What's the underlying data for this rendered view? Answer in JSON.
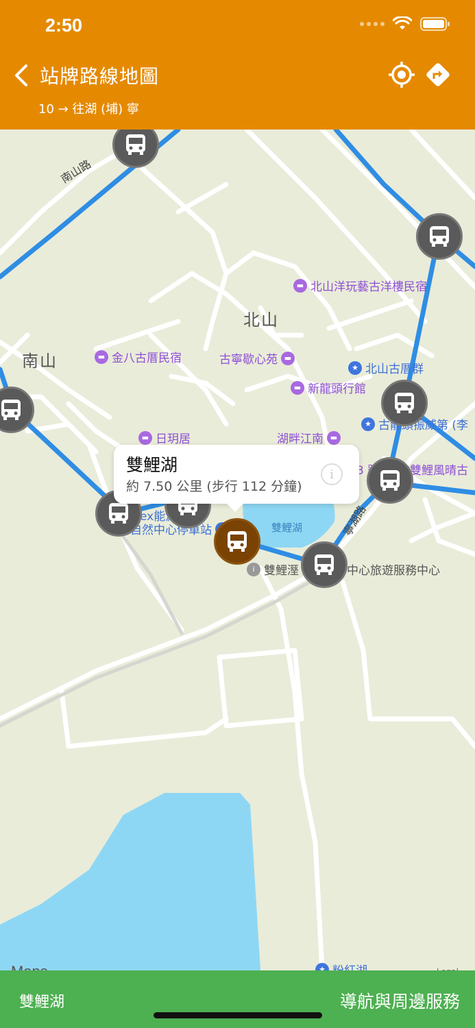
{
  "status_bar": {
    "time": "2:50"
  },
  "header": {
    "title": "站牌路線地圖",
    "subtitle": "10 → 往湖 (埔) 寧"
  },
  "map": {
    "place_labels": {
      "beishan": "北山",
      "nanshan": "南山"
    },
    "road_labels": {
      "nanshan_road": "南山路",
      "ningHu_road": "寧湖路"
    },
    "water_label": "雙鯉湖",
    "pois": {
      "p1": "北山洋玩藝古洋樓民宿",
      "p2": "金八古厝民宿",
      "p3": "古寧歇心苑",
      "p4": "北山古厝群",
      "p5": "新龍頭行館",
      "p6": "古龍頭振威第 (李",
      "p7": "日玥居",
      "p8": "湖畔江南",
      "p9": "3 號",
      "p10": "雙鯉風晴古",
      "p11": "ex能源站",
      "p12": "自然中心停車站",
      "p13": "雙鯉溼",
      "p14": "中心旅遊服務中心",
      "p15": "粉紅湖"
    },
    "maps_brand": "Maps",
    "legal": "Legal",
    "callout": {
      "title": "雙鯉湖",
      "subtitle": "約 7.50 公里 (步行 112 分鐘)"
    }
  },
  "bottom_bar": {
    "left_label": "雙鯉湖",
    "right_label": "導航與周邊服務"
  },
  "colors": {
    "header": "#e58a00",
    "bottom": "#4db051",
    "route": "#2f8de4",
    "stop": "#5a5a5a",
    "active_stop": "#7a4304",
    "water": "#8ed7f4"
  }
}
